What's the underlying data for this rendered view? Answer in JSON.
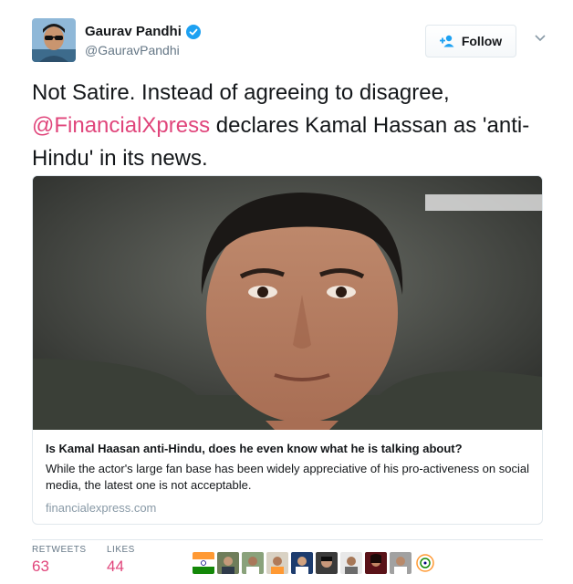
{
  "user": {
    "display_name": "Gaurav Pandhi",
    "handle": "@GauravPandhi",
    "verified_icon": "verified-badge-icon",
    "verified_color": "#1da1f2"
  },
  "follow": {
    "label": "Follow",
    "icon": "add-user-icon"
  },
  "tweet": {
    "text_before": "Not Satire. Instead of agreeing to disagree, ",
    "mention": "@FinancialXpress",
    "text_after": " declares Kamal Hassan as 'anti-Hindu' in its news.",
    "accent_color": "#e0457b"
  },
  "card": {
    "title": "Is Kamal Haasan anti-Hindu, does he even know what he is talking about?",
    "description": "While the actor's large fan base has been widely appreciative of his pro-activeness on social media, the latest one is not acceptable.",
    "domain": "financialexpress.com"
  },
  "stats": {
    "retweets_label": "RETWEETS",
    "retweets_count": "63",
    "likes_label": "LIKES",
    "likes_count": "44"
  }
}
